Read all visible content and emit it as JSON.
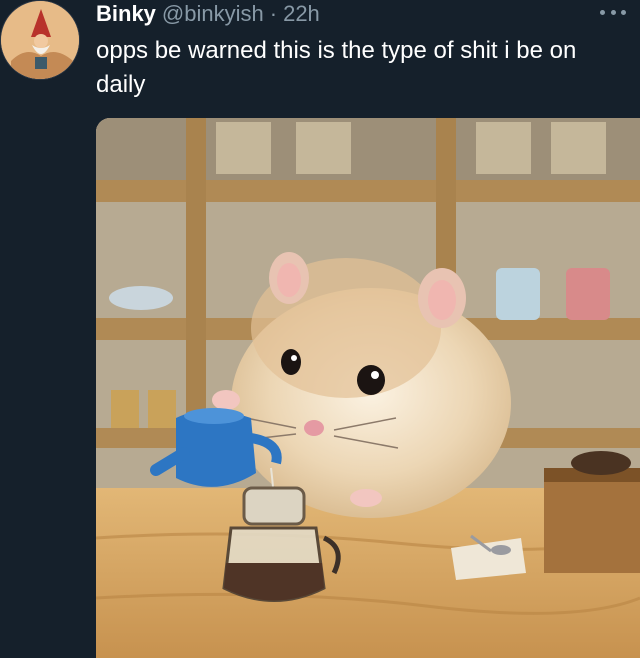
{
  "author": {
    "display_name": "Binky",
    "handle": "@binkyish",
    "separator": "·",
    "timestamp": "22h"
  },
  "tweet": {
    "text": "opps be warned this is the type of shit i be on daily"
  },
  "icons": {
    "avatar": "gnome-avatar",
    "more": "more-options-icon"
  },
  "colors": {
    "background": "#15202b",
    "secondary_text": "#8899a6",
    "primary_text": "#ffffff"
  }
}
